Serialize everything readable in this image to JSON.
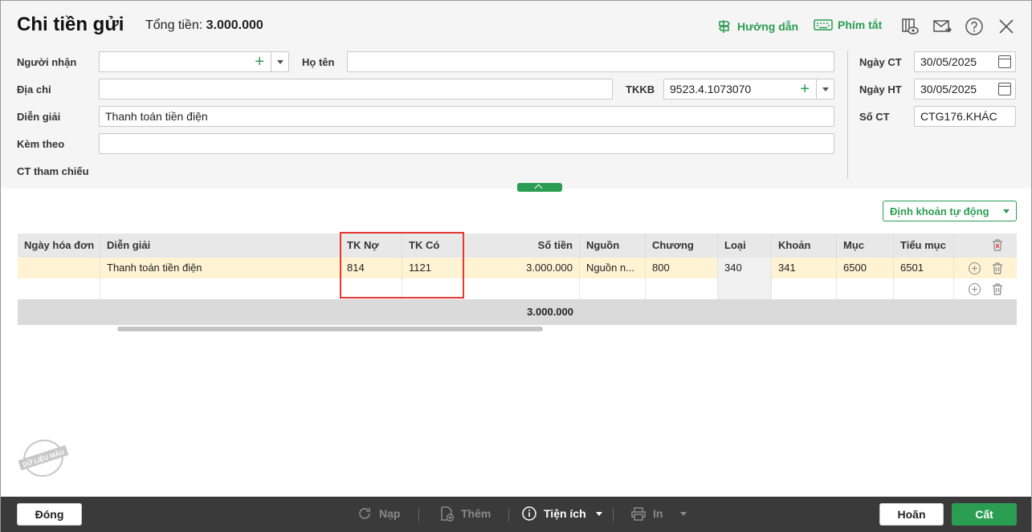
{
  "header": {
    "title": "Chi tiền gửi",
    "total_label": "Tổng tiền:",
    "total_value": "3.000.000",
    "guide_label": "Hướng dẫn",
    "shortcut_label": "Phím tắt"
  },
  "form": {
    "recipient_label": "Người nhận",
    "recipient_value": "",
    "fullname_label": "Họ tên",
    "fullname_value": "",
    "address_label": "Địa chỉ",
    "address_value": "",
    "tkkb_label": "TKKB",
    "tkkb_value": "9523.4.1073070",
    "description_label": "Diễn giải",
    "description_value": "Thanh toán tiền điện",
    "attach_label": "Kèm theo",
    "attach_value": "",
    "reference_label": "CT tham chiếu",
    "doc_date_label": "Ngày CT",
    "doc_date_value": "30/05/2025",
    "post_date_label": "Ngày HT",
    "post_date_value": "30/05/2025",
    "doc_no_label": "Số CT",
    "doc_no_value": "CTG176.KHÁC"
  },
  "auto_account_label": "Định khoản tự động",
  "table": {
    "columns": [
      "Ngày hóa đơn",
      "Diễn giải",
      "TK Nợ",
      "TK Có",
      "Số tiền",
      "Nguồn",
      "Chương",
      "Loại",
      "Khoản",
      "Mục",
      "Tiểu mục"
    ],
    "rows": [
      [
        "",
        "Thanh toán tiền điện",
        "814",
        "1121",
        "3.000.000",
        "Nguồn n...",
        "800",
        "340",
        "341",
        "6500",
        "6501"
      ]
    ],
    "sum": "3.000.000"
  },
  "stamp_text": "DỮ LIỆU MẪU",
  "footer": {
    "close_label": "Đóng",
    "reload_label": "Nạp",
    "add_label": "Thêm",
    "utility_label": "Tiện ích",
    "print_label": "In",
    "cancel_label": "Hoãn",
    "save_label": "Cất"
  },
  "colors": {
    "accent": "#2a9d52",
    "highlight_row": "#fff3d4",
    "annotation": "#e53935"
  }
}
